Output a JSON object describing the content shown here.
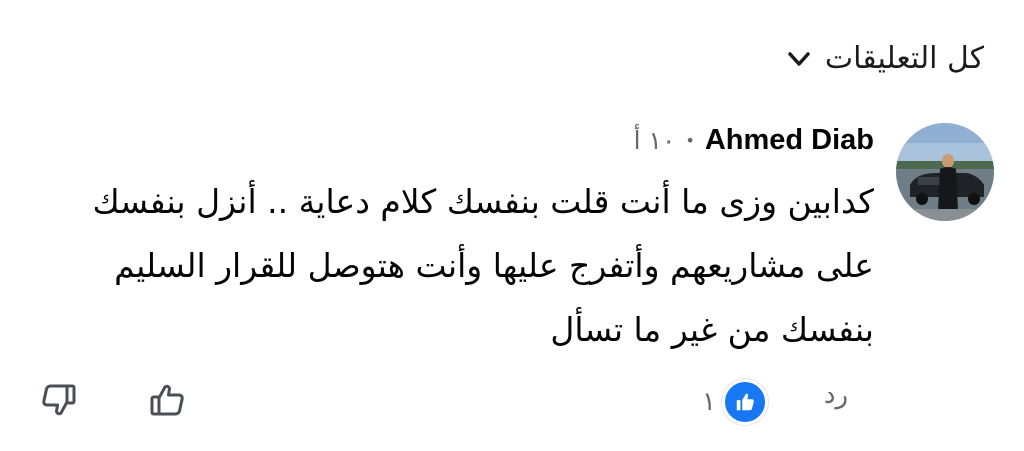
{
  "header": {
    "filter_label": "كل التعليقات",
    "chevron_icon": "chevron-down-icon"
  },
  "comment": {
    "author": "Ahmed Diab",
    "timestamp": "١٠ أ",
    "text_lines": [
      "كدابين وزى ما أنت قلت بنفسك كلام دعاية .. أنزل بنفسك",
      "على مشاريعهم وأتفرج عليها وأنت هتوصل للقرار السليم",
      "بنفسك من غير ما تسأل"
    ],
    "avatar_icon": "avatar-photo"
  },
  "actions": {
    "reply_label": "رد",
    "reaction_count": "١",
    "reaction_icon": "like-reaction-icon",
    "upvote_icon": "thumbs-up-icon",
    "downvote_icon": "thumbs-down-icon"
  },
  "colors": {
    "text_primary": "#050505",
    "text_secondary": "#65676b",
    "like_blue": "#1877f2"
  }
}
